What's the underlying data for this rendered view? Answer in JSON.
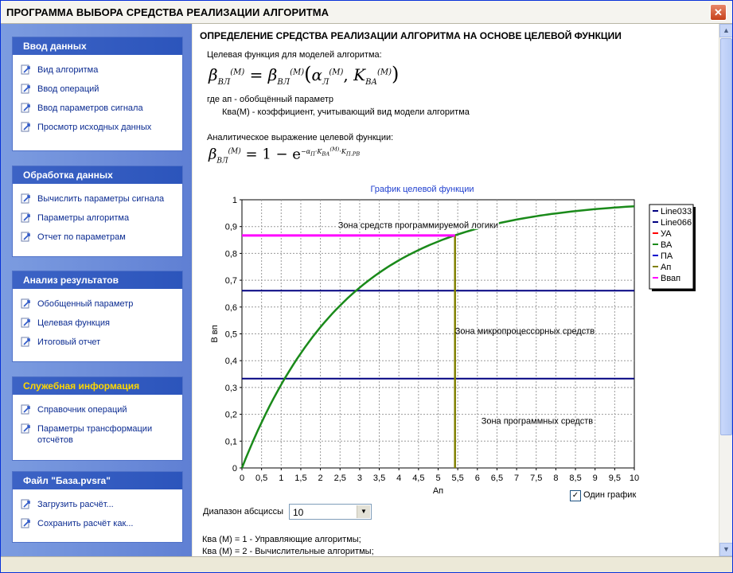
{
  "window": {
    "title": "ПРОГРАММА ВЫБОРА СРЕДСТВА РЕАЛИЗАЦИИ АЛГОРИТМА",
    "close_glyph": "✕"
  },
  "sidebar": {
    "groups": [
      {
        "header": "Ввод данных",
        "items": [
          {
            "label": "Вид алгоритма"
          },
          {
            "label": "Ввод операций"
          },
          {
            "label": "Ввод параметров сигнала"
          },
          {
            "label": "Просмотр исходных данных"
          }
        ]
      },
      {
        "header": "Обработка данных",
        "items": [
          {
            "label": "Вычислить параметры сигнала"
          },
          {
            "label": "Параметры алгоритма"
          },
          {
            "label": "Отчет по параметрам"
          }
        ]
      },
      {
        "header": "Анализ результатов",
        "items": [
          {
            "label": "Обобщенный параметр"
          },
          {
            "label": "Целевая функция"
          },
          {
            "label": "Итоговый отчет"
          }
        ]
      },
      {
        "header": "Служебная информация",
        "items": [
          {
            "label": "Справочник операций"
          },
          {
            "label": "Параметры трансформации отсчётов"
          }
        ]
      },
      {
        "header": "Файл \"База.pvsra\"",
        "items": [
          {
            "label": "Загрузить расчёт..."
          },
          {
            "label": "Сохранить расчёт как..."
          }
        ]
      }
    ],
    "accent": "#ffd800"
  },
  "main": {
    "heading": "ОПРЕДЕЛЕНИЕ СРЕДСТВА РЕАЛИЗАЦИИ АЛГОРИТМА НА ОСНОВЕ ЦЕЛЕВОЙ ФУНКЦИИ",
    "target_label": "Целевая функция для моделей алгоритма:",
    "formula1": {
      "lhs": "β",
      "lhs_sub": "ВЛ",
      "sup": "(M)",
      "eq": "=",
      "rhs_b": "β",
      "rhs_sub": "ВЛ",
      "rhs_sup": "(M)",
      "alpha": "α",
      "alpha_sub": "Л",
      "alpha_sup": "(M)",
      "comma": ",",
      "k": "K",
      "k_sub": "ВА",
      "k_sup": "(M)",
      "lparen": "(",
      "rparen": ")"
    },
    "where1": "где ап - обобщённый параметр",
    "where2": "Ква(М) - коэффициент, учитывающий вид модели алгоритма",
    "analytic_label": "Аналитическое выражение целевой функции:",
    "formula2": {
      "lhs": "β",
      "lhs_sub": "ВЛ",
      "lhs_sup": "(M)",
      "eq": "= 1 − e",
      "exp": "−α",
      "exp_sub": "П",
      "exp_k": "·K",
      "exp_k_sub": "ВА",
      "exp_k_sup": "(M)",
      "exp_k2": "·K",
      "exp_k2_sub": "П.РВ"
    },
    "range_label": "Диапазон абсциссы",
    "range_value": "10",
    "one_chart_label": "Один график",
    "one_chart_checked": "✓",
    "notes": [
      "Ква (М) = 1 - Управляющие алгоритмы;",
      "Ква (М) = 2 - Вычислительные алгоритмы;"
    ]
  },
  "chart_data": {
    "type": "line",
    "title": "График целевой функции",
    "xlabel": "Ап",
    "ylabel": "В вп",
    "xlim": [
      0,
      10
    ],
    "ylim": [
      0,
      1
    ],
    "x_ticks": [
      "0",
      "0,5",
      "1",
      "1,5",
      "2",
      "2,5",
      "3",
      "3,5",
      "4",
      "4,5",
      "5",
      "5,5",
      "6",
      "6,5",
      "7",
      "7,5",
      "8",
      "8,5",
      "9",
      "9,5",
      "10"
    ],
    "y_ticks": [
      "0",
      "0,1",
      "0,2",
      "0,3",
      "0,4",
      "0,5",
      "0,6",
      "0,7",
      "0,8",
      "0,9",
      "1"
    ],
    "grid": true,
    "legend_position": "right",
    "series": [
      {
        "name": "Line033",
        "color": "#000080",
        "kind": "hline",
        "y": 0.333
      },
      {
        "name": "Line066",
        "color": "#000080",
        "kind": "hline",
        "y": 0.661
      },
      {
        "name": "УА",
        "color": "#ff0000",
        "kind": "none"
      },
      {
        "name": "ВА",
        "color": "#1a8a1a",
        "kind": "curve",
        "k": 0.372,
        "x_from": 0,
        "x_to": 10
      },
      {
        "name": "ПА",
        "color": "#0000cc",
        "kind": "none"
      },
      {
        "name": "Ап",
        "color": "#808000",
        "kind": "vline",
        "x": 5.43,
        "y": 0.867
      },
      {
        "name": "Ввап",
        "color": "#ff00ff",
        "kind": "hseg",
        "y": 0.867,
        "x_to": 5.43
      }
    ],
    "annotations": [
      {
        "text": "Зона средств программируемой логики",
        "x": 2.45,
        "y": 0.895
      },
      {
        "text": "Зона микропроцессорных средств",
        "x": 5.43,
        "y": 0.5
      },
      {
        "text": "Зона программных средств",
        "x": 6.1,
        "y": 0.165
      }
    ]
  }
}
